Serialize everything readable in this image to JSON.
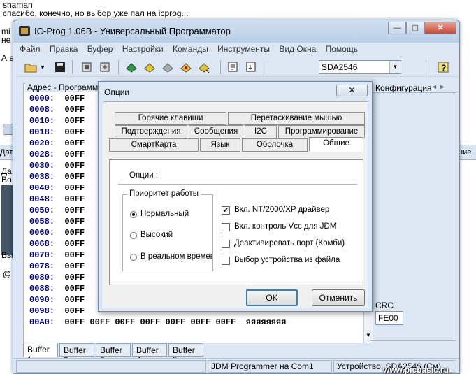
{
  "forum": {
    "author": "shaman",
    "message": "спасибо, конечно, но выбор уже пал на icprog...",
    "frag_mi": "mi",
    "frag_ne": "не",
    "frag_a": "А е",
    "frag_dat": "Дат",
    "frag_nie": "ние",
    "frag_da": "Да",
    "frag_vo": "Во",
    "frag_vy": "Вы",
    "frag_at": "@"
  },
  "window": {
    "title": "IC-Prog 1.06B - Универсальный Программатор",
    "minimize": "—",
    "maximize": "▢",
    "close": "✕"
  },
  "menu": [
    "Файл",
    "Правка",
    "Буфер",
    "Настройки",
    "Команды",
    "Инструменты",
    "Вид Окна",
    "Помощь"
  ],
  "toolbar": {
    "device": "SDA2546",
    "icons": [
      "open-folder-icon",
      "dropdown-arrow-icon",
      "save-disk-icon",
      "chip-read-icon",
      "chip-config-icon",
      "read-device-icon",
      "program-device-icon",
      "erase-device-icon",
      "verify-device-icon",
      "blank-check-icon",
      "copy-icon",
      "paste-icon",
      "help-icon"
    ]
  },
  "address_panel": {
    "header": "Адрес - Программн",
    "rows": [
      {
        "addr": "0000:",
        "data": "00FF"
      },
      {
        "addr": "0008:",
        "data": "00FF"
      },
      {
        "addr": "0010:",
        "data": "00FF"
      },
      {
        "addr": "0018:",
        "data": "00FF"
      },
      {
        "addr": "0020:",
        "data": "00FF"
      },
      {
        "addr": "0028:",
        "data": "00FF"
      },
      {
        "addr": "0030:",
        "data": "00FF"
      },
      {
        "addr": "0038:",
        "data": "00FF"
      },
      {
        "addr": "0040:",
        "data": "00FF"
      },
      {
        "addr": "0048:",
        "data": "00FF"
      },
      {
        "addr": "0050:",
        "data": "00FF"
      },
      {
        "addr": "0058:",
        "data": "00FF"
      },
      {
        "addr": "0060:",
        "data": "00FF"
      },
      {
        "addr": "0068:",
        "data": "00FF"
      },
      {
        "addr": "0070:",
        "data": "00FF"
      },
      {
        "addr": "0078:",
        "data": "00FF"
      },
      {
        "addr": "0080:",
        "data": "00FF"
      },
      {
        "addr": "0088:",
        "data": "00FF"
      },
      {
        "addr": "0090:",
        "data": "00FF"
      },
      {
        "addr": "0098:",
        "data": "00FF"
      },
      {
        "addr": "00A0:",
        "data": "00FF 00FF 00FF 00FF 00FF 00FF 00FF  яяяяяяяя"
      }
    ]
  },
  "config": {
    "label": "Конфигурация",
    "arrows": "◄ ►",
    "crc_label": "CRC",
    "crc_value": "FE00"
  },
  "buffers": [
    "Buffer 1",
    "Buffer 2",
    "Buffer 3",
    "Buffer 4",
    "Buffer 5"
  ],
  "status": {
    "programmer": "JDM Programmer на Com1",
    "device": "Устройство: SDA2546 (См)"
  },
  "dialog": {
    "title": "Опции",
    "close": "✕",
    "tabs_row1": [
      "Горячие клавиши",
      "Перетаскивание мышью"
    ],
    "tabs_row2": [
      "Подтверждения",
      "Сообщения",
      "I2C",
      "Программирование"
    ],
    "tabs_row3": [
      "СмартКарта",
      "Язык",
      "Оболочка",
      "Общие"
    ],
    "page_title": "Опции :",
    "group_title": "Приоритет работы",
    "priorities": [
      {
        "label": "Нормальный",
        "selected": true
      },
      {
        "label": "Высокий",
        "selected": false
      },
      {
        "label": "В реальном времени",
        "selected": false
      }
    ],
    "checks": [
      {
        "label": "Вкл. NT/2000/XP драйвер",
        "checked": true
      },
      {
        "label": "Вкл. контроль Vcc для JDM",
        "checked": false
      },
      {
        "label": "Деактивировать порт (Комби)",
        "checked": false
      },
      {
        "label": "Выбор устройства из файла",
        "checked": false
      }
    ],
    "ok": "OK",
    "cancel": "Отменить"
  },
  "watermark": "www.picbasic.ru"
}
